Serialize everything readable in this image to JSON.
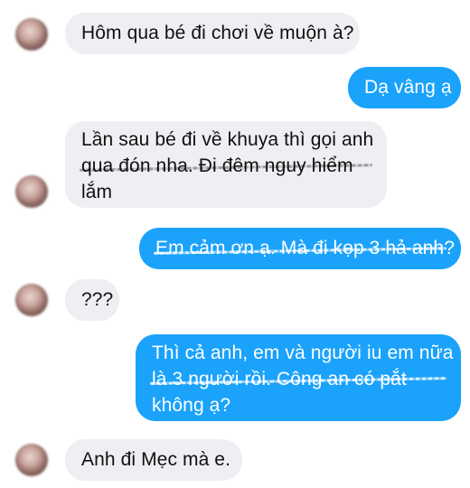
{
  "messages": [
    {
      "side": "in",
      "lines": [
        "Hôm qua bé đi chơi về muộn à?"
      ]
    },
    {
      "side": "out",
      "lines": [
        "Dạ vâng ạ"
      ]
    },
    {
      "side": "in",
      "lines": [
        "Lần sau bé đi về khuya thì gọi anh",
        "qua đón nha. Đi đêm nguy hiểm",
        "lắm"
      ]
    },
    {
      "side": "out",
      "lines": [
        "Em cảm ơn ạ. Mà đi kẹp 3 hả anh?"
      ]
    },
    {
      "side": "in",
      "lines": [
        "???"
      ]
    },
    {
      "side": "out",
      "lines": [
        "Thì cả anh, em và người iu em nữa",
        "là 3 người rồi. Công an có pắt",
        "không ạ?"
      ]
    },
    {
      "side": "in",
      "lines": [
        "Anh đi Mẹc mà e."
      ]
    }
  ],
  "colors": {
    "incoming_bubble": "#eeeff2",
    "outgoing_bubble": "#1ba2fb",
    "incoming_text": "#111111",
    "outgoing_text": "#ffffff"
  },
  "icons": {
    "avatar": "blurred-profile-avatar-icon"
  }
}
